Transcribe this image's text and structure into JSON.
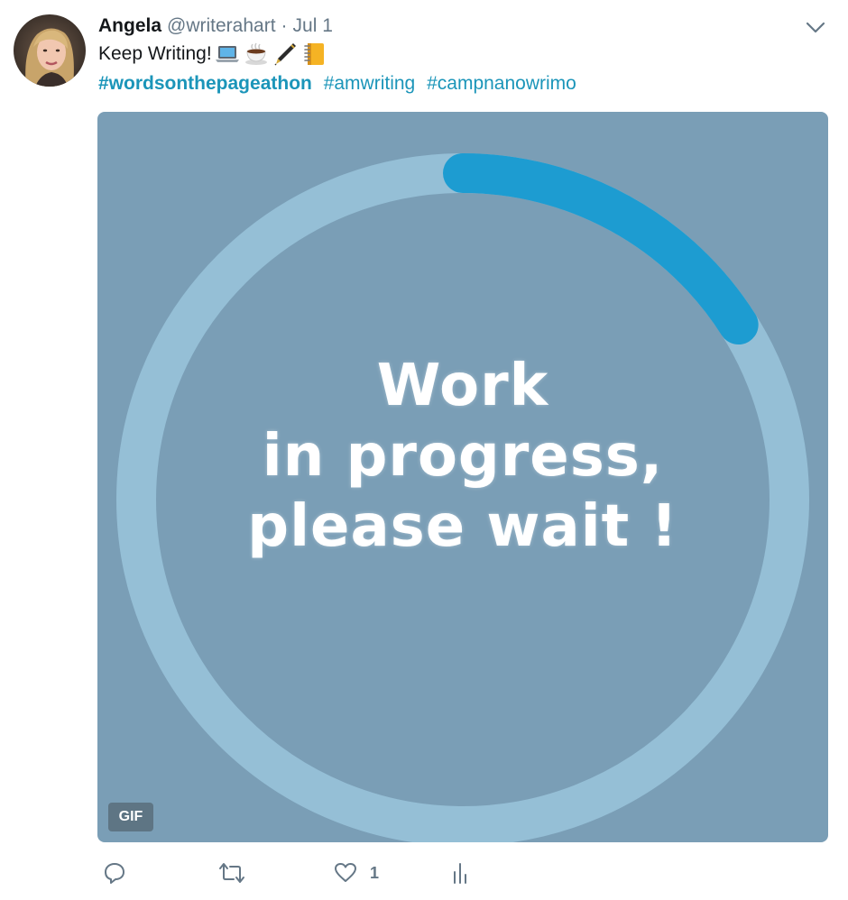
{
  "tweet": {
    "author_name": "Angela",
    "author_handle": "@writerahart",
    "separator": "·",
    "timestamp": "Jul 1",
    "text": "Keep Writing!",
    "emojis": [
      "laptop-emoji",
      "hot-beverage-emoji",
      "pen-emoji",
      "notebook-emoji"
    ],
    "hashtags": [
      {
        "text": "#wordsonthepageathon",
        "bold": true
      },
      {
        "text": "#amwriting",
        "bold": false
      },
      {
        "text": "#campnanowrimo",
        "bold": false
      }
    ]
  },
  "media": {
    "line1": "Work",
    "line2": "in progress,",
    "line3": "please wait !",
    "badge": "GIF",
    "progress_fraction": 0.16,
    "colors": {
      "background": "#7a9eb6",
      "track": "#95bfd6",
      "arc": "#1d9cd1"
    }
  },
  "actions": {
    "reply_icon": "reply-icon",
    "retweet_icon": "retweet-icon",
    "like_icon": "heart-icon",
    "like_count": "1",
    "analytics_icon": "analytics-icon"
  },
  "colors": {
    "hashtag": "#1b95b9",
    "muted": "#657786",
    "text": "#14171a"
  }
}
